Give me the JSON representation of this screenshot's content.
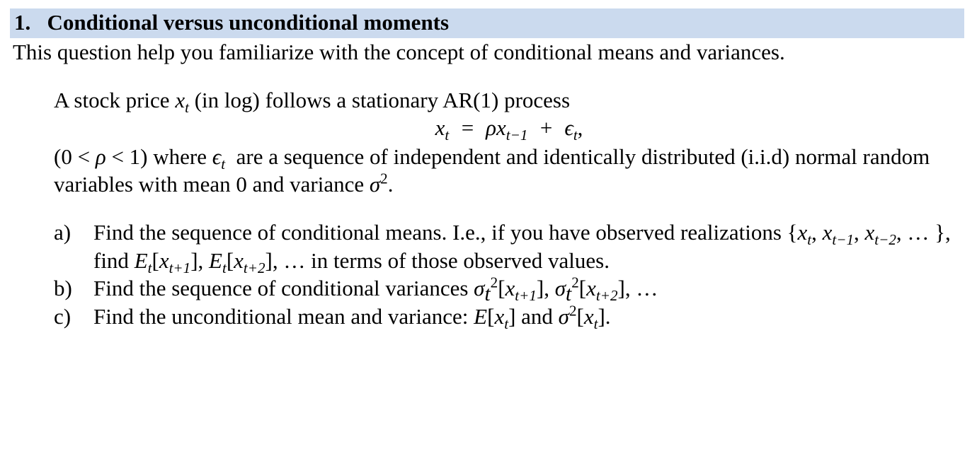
{
  "heading": {
    "number": "1.",
    "title": "Conditional versus unconditional moments"
  },
  "intro": "This question help you familiarize with the concept of conditional means and variances.",
  "setup": {
    "line1_pre": "A stock price ",
    "line1_var": "x",
    "line1_sub": "t",
    "line1_post": " (in log) follows a stationary AR(1) process",
    "equation": "x_t = ρ x_{t−1} + ϵ_t,",
    "line2": "(0 < ρ < 1) where ϵ_t  are a sequence of independent and identically distributed (i.i.d) normal random variables with mean 0 and variance σ²."
  },
  "parts": {
    "a": {
      "label": "a)",
      "text": "Find the sequence of conditional means. I.e., if you have observed realizations {x_t, x_{t−1}, x_{t−2}, … }, find E_t[x_{t+1}], E_t[x_{t+2}], … in terms of those observed values."
    },
    "b": {
      "label": "b)",
      "text": "Find the sequence of conditional variances σ_t²[x_{t+1}], σ_t²[x_{t+2}], …"
    },
    "c": {
      "label": "c)",
      "text": "Find the unconditional mean and variance: E[x_t] and σ²[x_t]."
    }
  }
}
